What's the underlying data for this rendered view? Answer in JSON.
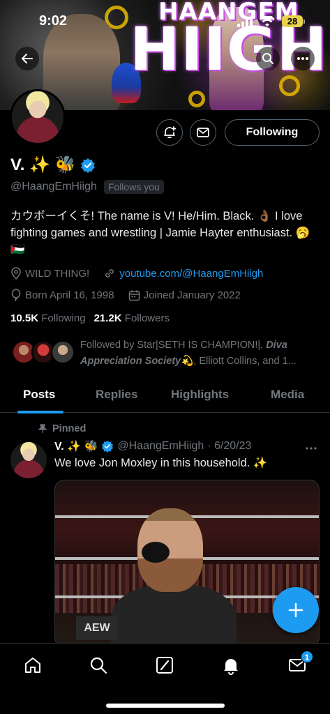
{
  "status_bar": {
    "time": "9:02",
    "battery": "28"
  },
  "banner": {
    "title_top": "HAANGEM",
    "title_bottom": "HIIGH"
  },
  "profile": {
    "display_name": "V. ✨ 🐝",
    "handle": "@HaangEmHiigh",
    "follows_you": "Follows you",
    "bio": "カウボーイくそ! The name is V! He/Him. Black. 👌🏾 I love fighting games and wrestling | Jamie Hayter enthusiast. 🥱 🇵🇸",
    "location": "WILD THING!",
    "website": "youtube.com/@HaangEmHiigh",
    "born": "Born April 16, 1998",
    "joined": "Joined January 2022",
    "following_count": "10.5K",
    "following_label": "Following",
    "followers_count": "21.2K",
    "followers_label": "Followers",
    "followed_by_prefix": "Followed by Star|SETH IS CHAMPION!|,",
    "followed_by_italic": "Diva Appreciation Society💫",
    "followed_by_suffix": ", Elliott Collins, and 1..."
  },
  "actions": {
    "following_button": "Following"
  },
  "tabs": [
    {
      "label": "Posts",
      "active": true
    },
    {
      "label": "Replies",
      "active": false
    },
    {
      "label": "Highlights",
      "active": false
    },
    {
      "label": "Media",
      "active": false
    }
  ],
  "post": {
    "pinned_label": "Pinned",
    "author_name": "V. ✨ 🐝",
    "author_handle": "@HaangEmHiigh",
    "date": "· 6/20/23",
    "text": "We love Jon Moxley in this household. ✨",
    "media_sign": "AEW"
  },
  "bottom_nav": {
    "messages_badge": "1"
  },
  "colors": {
    "accent": "#1d9bf0",
    "background": "#000000",
    "muted": "#71767b",
    "text": "#e7e9ea"
  },
  "icons": [
    "back-arrow-icon",
    "search-icon",
    "more-icon",
    "notification-bell-icon",
    "mail-icon",
    "verified-badge-icon",
    "location-icon",
    "link-icon",
    "balloon-icon",
    "calendar-icon",
    "pin-icon",
    "plus-icon",
    "home-icon",
    "compose-icon",
    "bell-icon",
    "envelope-icon"
  ]
}
